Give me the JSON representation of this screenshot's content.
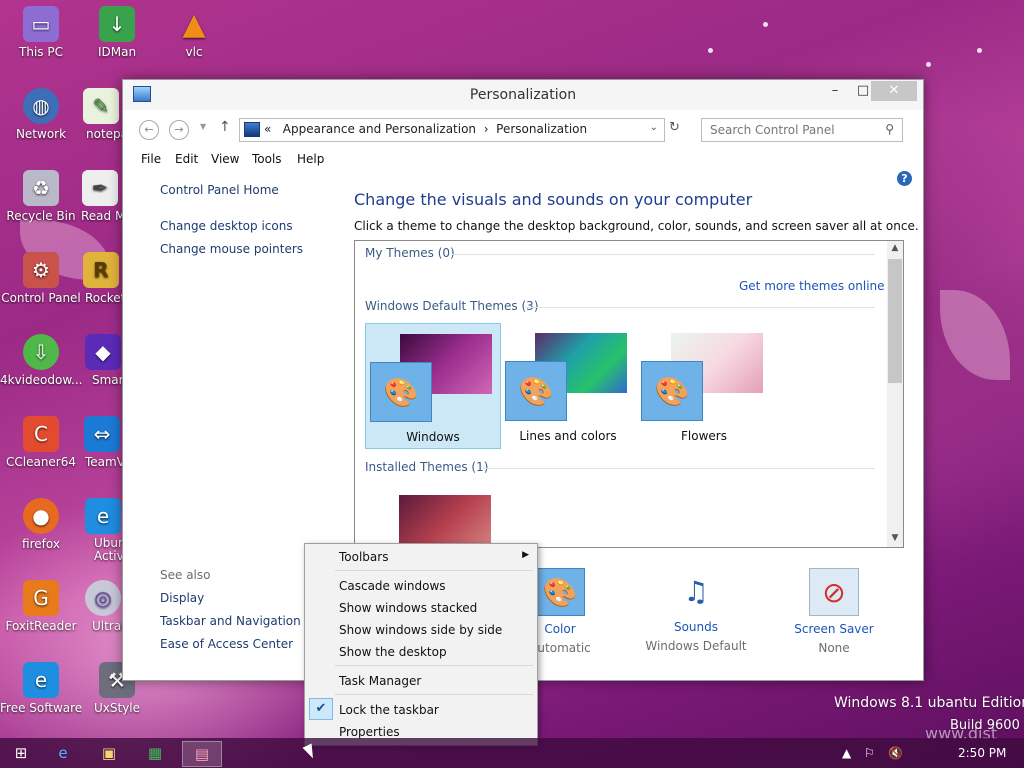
{
  "desktop": {
    "icons": [
      {
        "label": "This PC",
        "icon": "monitor-icon"
      },
      {
        "label": "IDMan",
        "icon": "download-icon"
      },
      {
        "label": "vlc",
        "icon": "cone-icon"
      },
      {
        "label": "Network",
        "icon": "globe-icon"
      },
      {
        "label": "notepa",
        "icon": "notepad-icon"
      },
      {
        "label": "Recycle Bin",
        "icon": "recycle-bin-icon"
      },
      {
        "label": "Read M",
        "icon": "document-icon"
      },
      {
        "label": "Control Panel",
        "icon": "control-panel-icon"
      },
      {
        "label": "Rocket",
        "icon": "rocket-icon"
      },
      {
        "label": "4kvideodow...",
        "icon": "video-download-icon"
      },
      {
        "label": "Smart",
        "icon": "smart-icon"
      },
      {
        "label": "CCleaner64",
        "icon": "ccleaner-icon"
      },
      {
        "label": "TeamVi",
        "icon": "teamviewer-icon"
      },
      {
        "label": "firefox",
        "icon": "firefox-icon"
      },
      {
        "label": "Ubun Activa",
        "icon": "ie-icon"
      },
      {
        "label": "FoxitReader",
        "icon": "pdf-icon"
      },
      {
        "label": "Ultral",
        "icon": "disc-icon"
      },
      {
        "label": "Free Software",
        "icon": "ie-icon"
      },
      {
        "label": "UxStyle",
        "icon": "computer-icon"
      }
    ]
  },
  "window": {
    "title": "Personalization",
    "controls": {
      "minimize": "–",
      "maximize": "□",
      "close": "✕"
    },
    "address": {
      "prefix": "«",
      "segments": [
        "Appearance and Personalization",
        "Personalization"
      ],
      "separator": "›"
    },
    "search_placeholder": "Search Control Panel",
    "menu": [
      "File",
      "Edit",
      "View",
      "Tools",
      "Help"
    ],
    "sidebar": {
      "home": "Control Panel Home",
      "links": [
        "Change desktop icons",
        "Change mouse pointers"
      ],
      "see_also_title": "See also",
      "see_also": [
        "Display",
        "Taskbar and Navigation",
        "Ease of Access Center"
      ]
    },
    "main": {
      "title": "Change the visuals and sounds on your computer",
      "description": "Click a theme to change the desktop background, color, sounds, and screen saver all at once.",
      "my_themes": "My Themes (0)",
      "get_more": "Get more themes online",
      "default_themes": "Windows Default Themes (3)",
      "themes": [
        {
          "name": "Windows",
          "selected": true
        },
        {
          "name": "Lines and colors",
          "selected": false
        },
        {
          "name": "Flowers",
          "selected": false
        }
      ],
      "installed_themes": "Installed Themes (1)"
    },
    "bottom": [
      {
        "title": "Color",
        "subtitle": "Automatic",
        "icon": "color-fan-icon"
      },
      {
        "title": "Sounds",
        "subtitle": "Windows Default",
        "icon": "sounds-icon"
      },
      {
        "title": "Screen Saver",
        "subtitle": "None",
        "icon": "screen-saver-icon"
      }
    ]
  },
  "context_menu": {
    "items": [
      "Toolbars",
      "Cascade windows",
      "Show windows stacked",
      "Show windows side by side",
      "Show the desktop",
      "Task Manager",
      "Lock the taskbar",
      "Properties"
    ],
    "checked": "Lock the taskbar"
  },
  "watermark": {
    "line1": "Windows 8.1 ubantu Edition",
    "line2": "Build 9600",
    "site": "www.dist"
  },
  "taskbar": {
    "clock": "2:50 PM"
  }
}
